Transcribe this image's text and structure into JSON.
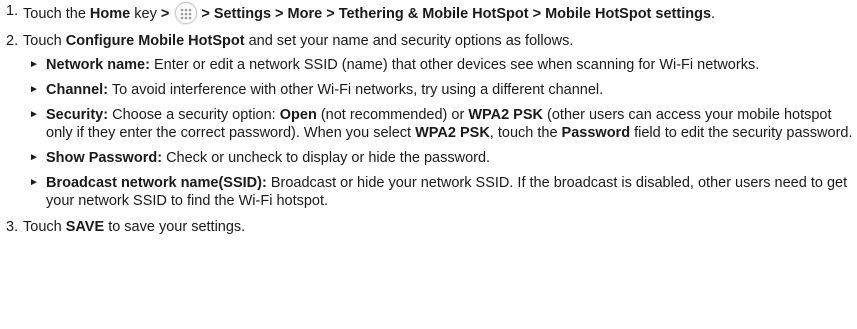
{
  "steps": [
    {
      "num": "1.",
      "touch": "Touch the",
      "home": "Home",
      "key": "key",
      "gt": ">",
      "apps_icon": "apps-grid-icon",
      "path": "> Settings > More > Tethering & Mobile HotSpot > Mobile HotSpot settings",
      "end": "."
    },
    {
      "num": "2.",
      "touch": "Touch",
      "configure": "Configure Mobile HotSpot",
      "rest": "and set your name and security options as follows.",
      "items": [
        {
          "label": "Network name:",
          "text": "Enter or edit a network SSID (name) that other devices see when scanning for Wi-Fi networks."
        },
        {
          "label": "Channel:",
          "text": "To avoid interference with other Wi-Fi networks, try using a different channel."
        },
        {
          "label": "Security:",
          "t1": "Choose a security option:",
          "open": "Open",
          "t2": "(not recommended) or",
          "wpa": "WPA2 PSK",
          "t3": "(other users can access your mobile hotspot only if they enter the correct password). When you select",
          "wpa2": "WPA2 PSK",
          "t4": ", touch the",
          "password": "Password",
          "t5": "field to edit the security password."
        },
        {
          "label": "Show Password:",
          "text": "Check or uncheck to display or hide the password."
        },
        {
          "label": "Broadcast network name(SSID):",
          "text": "Broadcast or hide your network SSID. If the broadcast is disabled, other users need to get your network SSID to find the Wi-Fi hotspot."
        }
      ]
    },
    {
      "num": "3.",
      "touch": "Touch",
      "save": "SAVE",
      "rest": "to save your settings."
    }
  ],
  "bullet_glyph": "►"
}
